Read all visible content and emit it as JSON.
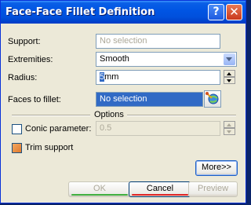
{
  "window": {
    "title": "Face-Face Fillet Definition"
  },
  "titlebar": {
    "help_label": "?",
    "close_label": "✕"
  },
  "support": {
    "label": "Support:",
    "value": "No selection"
  },
  "extremities": {
    "label": "Extremities:",
    "value": "Smooth"
  },
  "radius": {
    "label": "Radius:",
    "value_selected": "5",
    "value_rest": "mm"
  },
  "faces": {
    "label": "Faces to fillet:",
    "value": "No selection",
    "icon": "edge-selection-icon"
  },
  "options": {
    "title": "Options"
  },
  "conic": {
    "label": "Conic parameter:",
    "value": "0.5",
    "checked": false
  },
  "trim": {
    "label": "Trim support",
    "checked": true
  },
  "buttons": {
    "more": "More>>",
    "ok": "OK",
    "cancel": "Cancel",
    "preview": "Preview"
  },
  "colors": {
    "titlebar": "#0054e3",
    "selection": "#316ac5",
    "dialog_bg": "#ece9d8"
  }
}
